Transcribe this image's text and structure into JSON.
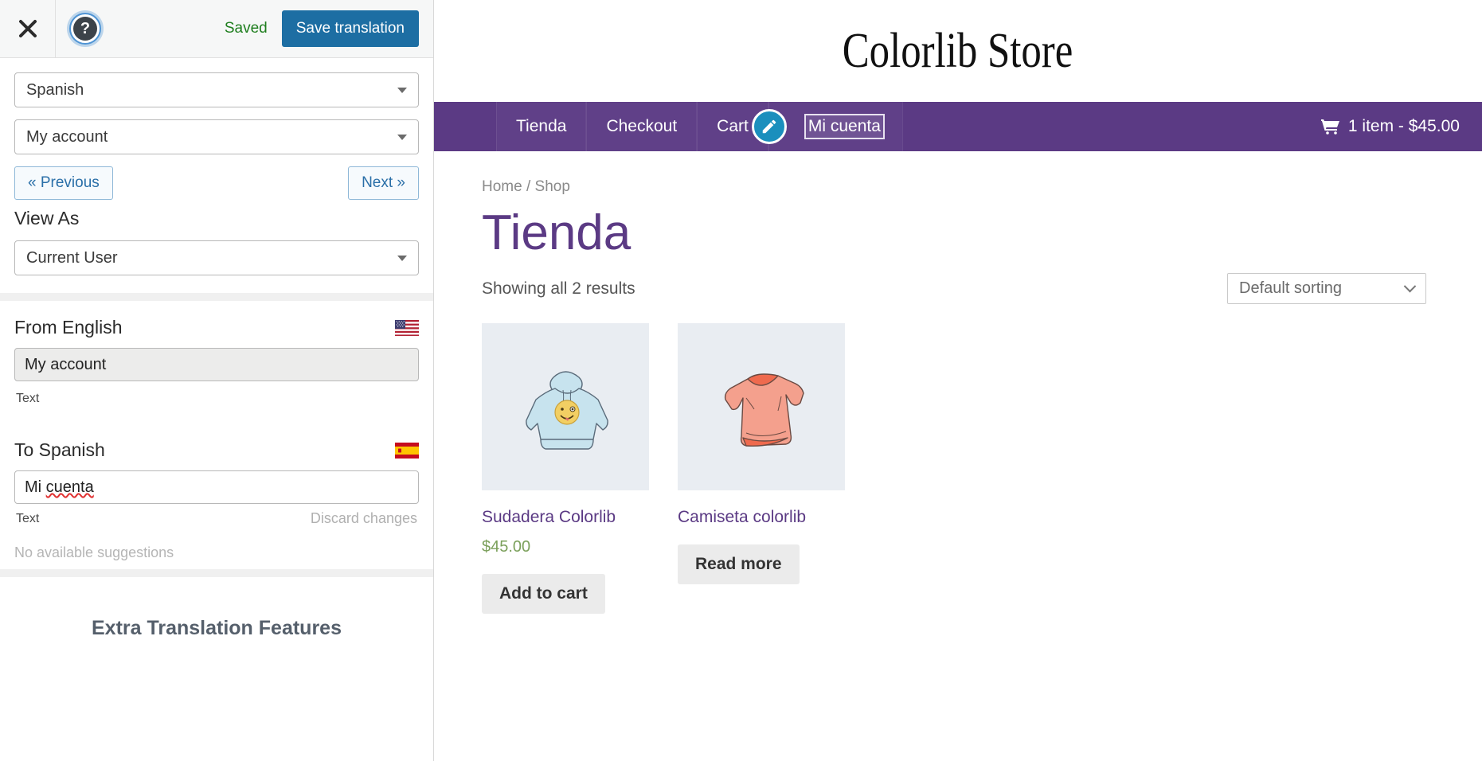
{
  "panel": {
    "toolbar": {
      "close_icon": "close-x-icon",
      "help_icon": "help-question-icon",
      "saved_label": "Saved",
      "save_button": "Save translation"
    },
    "language_select": "Spanish",
    "string_select": "My account",
    "prev_button": "« Previous",
    "next_button": "Next »",
    "view_as_label": "View As",
    "view_as_select": "Current User",
    "source": {
      "title": "From English",
      "flag": "us-flag-icon",
      "value": "My account",
      "type_label": "Text"
    },
    "target": {
      "title": "To Spanish",
      "flag": "es-flag-icon",
      "value_prefix": "Mi ",
      "value_misspelled": "cuenta",
      "type_label": "Text",
      "discard_label": "Discard changes",
      "suggestions": "No available suggestions"
    },
    "extra_title": "Extra Translation Features"
  },
  "site": {
    "title": "Colorlib Store",
    "nav": {
      "items": [
        {
          "label": "Tienda",
          "highlighted": false
        },
        {
          "label": "Checkout",
          "highlighted": false
        },
        {
          "label": "Cart",
          "highlighted": false
        },
        {
          "label": "Mi cuenta",
          "highlighted": true
        }
      ],
      "edit_icon": "pencil-edit-icon",
      "cart_icon": "shopping-cart-icon",
      "cart_label": "1 item - $45.00"
    },
    "breadcrumb": {
      "home": "Home",
      "separator": "/",
      "current": "Shop"
    },
    "page_title": "Tienda",
    "result_count": "Showing all 2 results",
    "sorting": "Default sorting",
    "products": [
      {
        "image": "blue-hoodie-image",
        "name": "Sudadera Colorlib",
        "price": "$45.00",
        "button": "Add to cart"
      },
      {
        "image": "coral-tshirt-image",
        "name": "Camiseta colorlib",
        "price": "",
        "button": "Read more"
      }
    ]
  },
  "colors": {
    "nav_purple": "#5b3a84",
    "accent_blue": "#1d6ea3",
    "saved_green": "#1e7e1e",
    "price_green": "#7ba05b",
    "edit_badge": "#1b8fbd"
  }
}
